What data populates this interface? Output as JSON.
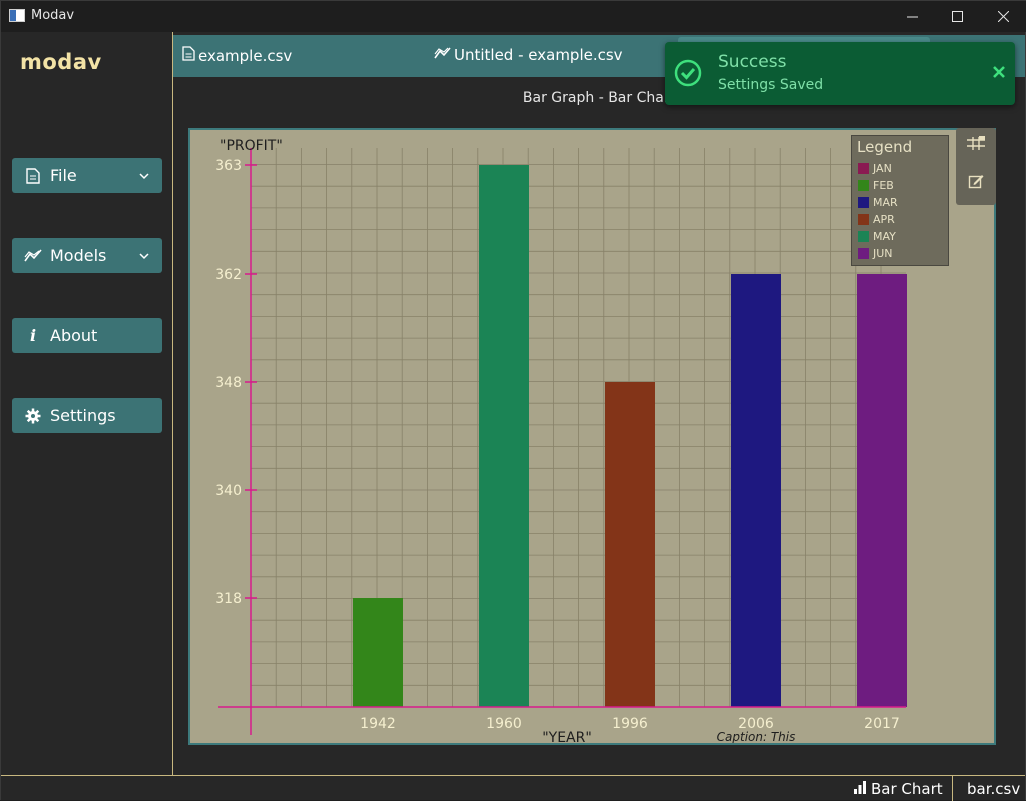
{
  "window": {
    "title": "Modav"
  },
  "sidebar": {
    "logo": "modav",
    "items": [
      {
        "label": "File",
        "icon": "file-icon",
        "has_dropdown": true
      },
      {
        "label": "Models",
        "icon": "line-chart-icon",
        "has_dropdown": true
      },
      {
        "label": "About",
        "icon": "info-icon",
        "has_dropdown": false
      },
      {
        "label": "Settings",
        "icon": "gear-icon",
        "has_dropdown": false
      }
    ]
  },
  "tabs": [
    {
      "label": "example.csv",
      "icon": "file-icon"
    },
    {
      "label": "Untitled - example.csv",
      "icon": "line-chart-icon"
    }
  ],
  "toast": {
    "title": "Success",
    "message": "Settings Saved",
    "icon": "check-circle-icon",
    "close_icon": "close-icon",
    "color": "#0b5c34"
  },
  "chart_header": "Bar Graph - Bar Chart",
  "toolbar": {
    "tools": [
      "grid-toggle-icon",
      "edit-icon"
    ]
  },
  "chart_data": {
    "type": "bar",
    "ylabel": "\"PROFIT\"",
    "xlabel": "\"YEAR\"",
    "caption": "Caption: This",
    "categories": [
      "1942",
      "1960",
      "1996",
      "2006",
      "2017"
    ],
    "y_tick_labels": [
      "318",
      "340",
      "348",
      "362",
      "363"
    ],
    "y_tick_level": [
      1,
      2,
      3,
      4,
      5
    ],
    "values_level": [
      1,
      5,
      3,
      4,
      4
    ],
    "bar_colors": [
      "#33861a",
      "#1b8455",
      "#833418",
      "#1e1880",
      "#6e1c80"
    ],
    "legend": {
      "title": "Legend",
      "items": [
        {
          "label": "JAN",
          "color": "#8a1a52"
        },
        {
          "label": "FEB",
          "color": "#33861a"
        },
        {
          "label": "MAR",
          "color": "#1e1880"
        },
        {
          "label": "APR",
          "color": "#833418"
        },
        {
          "label": "MAY",
          "color": "#1b8455"
        },
        {
          "label": "JUN",
          "color": "#6e1c80"
        }
      ]
    },
    "grid": true,
    "axis_color": "#d81b8c",
    "tick_label_color": "#f5efcf"
  },
  "statusbar": {
    "chart_type": "Bar Chart",
    "file": "bar.csv"
  }
}
